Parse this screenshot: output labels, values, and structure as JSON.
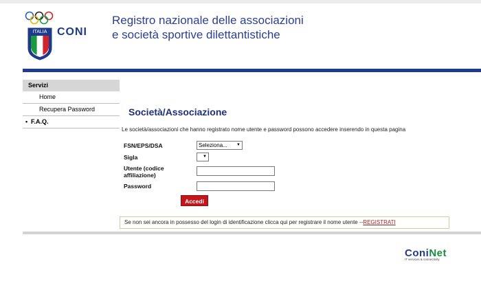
{
  "header": {
    "logo_caption": "ITALIA",
    "logo_brand": "CONI",
    "title_line1": "Registro nazionale delle associazioni",
    "title_line2": "e società sportive dilettantistiche"
  },
  "sidebar": {
    "heading": "Servizi",
    "items": [
      {
        "label": "Home"
      },
      {
        "label": "Recupera Password"
      },
      {
        "label": "F.A.Q.",
        "bullet": "•"
      }
    ]
  },
  "main": {
    "title": "Società/Associazione",
    "intro": "Le società/associazioni che hanno registrato nome utente e password possono accedere inserendo in questa pagina",
    "form": {
      "fsn_label": "FSN/EPS/DSA",
      "fsn_value": "Seleziona...",
      "sigla_label": "Sigla",
      "sigla_value": "",
      "utente_label": "Utente (codice affiliazione)",
      "utente_value": "",
      "password_label": "Password",
      "password_value": "",
      "submit_label": "Accedi"
    },
    "notice": {
      "text": "Se non sei ancora in possesso del login di identificazione clicca qui per registrare il nome utente --",
      "link": "REGISTRATI"
    }
  },
  "footer": {
    "brand_part1": "Coni",
    "brand_part2": "Net",
    "tagline": "IT services & connectivity"
  },
  "colors": {
    "accent_blue": "#1f3a93",
    "button_red": "#c4161c",
    "link_red": "#a21f1f",
    "brand_green": "#138f3b"
  }
}
